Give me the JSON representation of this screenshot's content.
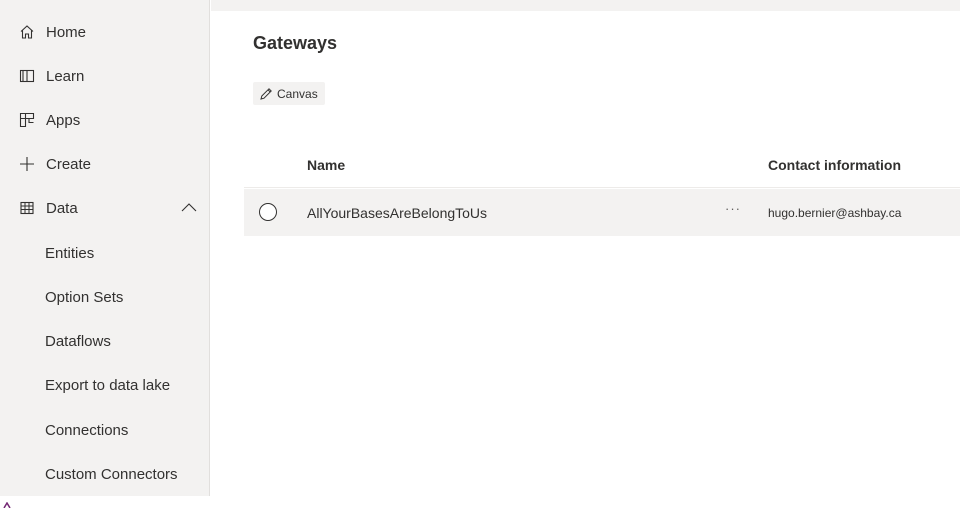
{
  "sidebar": {
    "items": [
      {
        "label": "Home",
        "icon": "home-icon"
      },
      {
        "label": "Learn",
        "icon": "book-icon"
      },
      {
        "label": "Apps",
        "icon": "apps-icon"
      },
      {
        "label": "Create",
        "icon": "plus-icon"
      },
      {
        "label": "Data",
        "icon": "table-icon",
        "expanded": true
      },
      {
        "label": "Entities"
      },
      {
        "label": "Option Sets"
      },
      {
        "label": "Dataflows"
      },
      {
        "label": "Export to data lake"
      },
      {
        "label": "Connections"
      },
      {
        "label": "Custom Connectors"
      }
    ]
  },
  "main": {
    "title": "Gateways",
    "filter_chip": {
      "label": "Canvas",
      "icon": "pencil-icon"
    },
    "table": {
      "columns": [
        "Name",
        "Contact information"
      ],
      "rows": [
        {
          "name": "AllYourBasesAreBelongToUs",
          "more": "···",
          "contact": "hugo.bernier@ashbay.ca"
        }
      ]
    }
  },
  "colors": {
    "sidebar_bg": "#f3f2f1",
    "row_bg": "#f3f2f1",
    "text": "#323130"
  }
}
